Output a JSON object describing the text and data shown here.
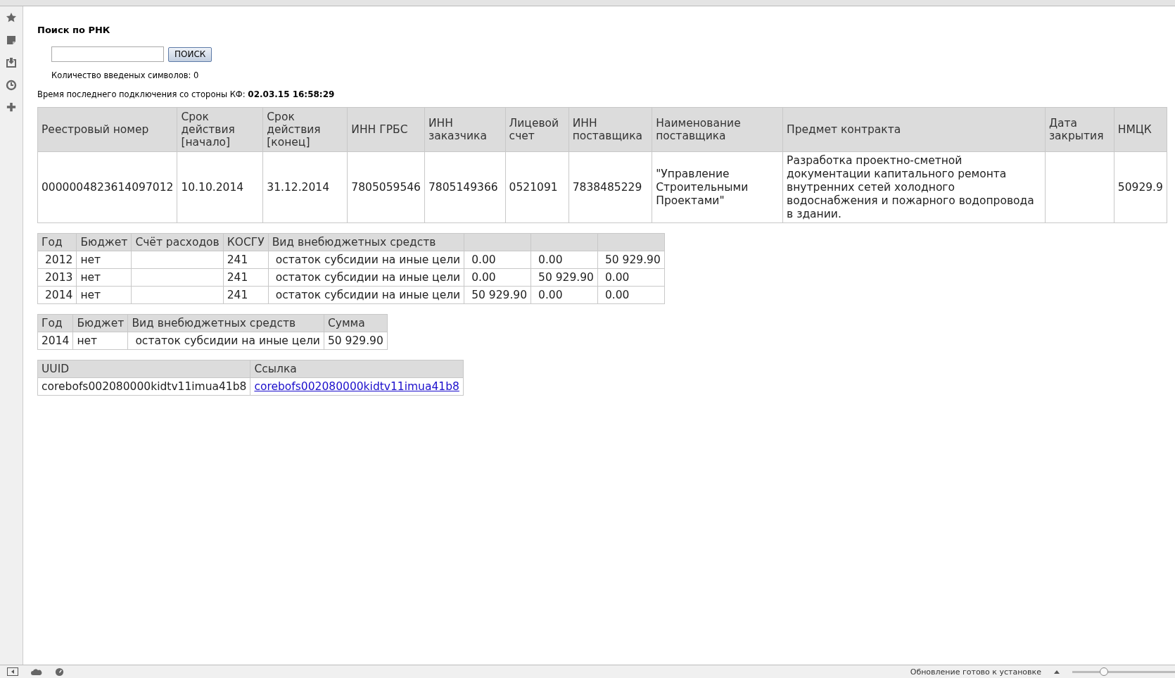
{
  "search": {
    "title": "Поиск по РНК",
    "button": "ПОИСК",
    "counter": "Количество введеных символов: 0"
  },
  "connection": {
    "label": "Время последнего подключения со стороны КФ:",
    "value": "02.03.15 16:58:29"
  },
  "contract_table": {
    "columns": [
      "Реестровый номер",
      "Срок действия [начало]",
      "Срок действия [конец]",
      "ИНН ГРБС",
      "ИНН заказчика",
      "Лицевой счет",
      "ИНН поставщика",
      "Наименование поставщика",
      "Предмет контракта",
      "Дата закрытия",
      "НМЦК"
    ],
    "rows": [
      [
        "0000004823614097012",
        "10.10.2014",
        "31.12.2014",
        "7805059546",
        "7805149366",
        "0521091",
        "7838485229",
        "\"Управление Строительными Проектами\"",
        "Разработка проектно-сметной документации капитального ремонта внутренних сетей холодного водоснабжения и пожарного водопровода в здании.",
        "",
        "50929.9"
      ]
    ]
  },
  "finance_table": {
    "columns": [
      "Год",
      "Бюджет",
      "Счёт расходов",
      "КОСГУ",
      "Вид внебюджетных средств",
      "",
      "",
      ""
    ],
    "rows": [
      [
        "2012",
        "нет",
        "",
        "241",
        "остаток субсидии на иные цели",
        "0.00",
        "0.00",
        "50 929.90"
      ],
      [
        "2013",
        "нет",
        "",
        "241",
        "остаток субсидии на иные цели",
        "0.00",
        "50 929.90",
        "0.00"
      ],
      [
        "2014",
        "нет",
        "",
        "241",
        "остаток субсидии на иные цели",
        "50 929.90",
        "0.00",
        "0.00"
      ]
    ]
  },
  "sum_table": {
    "columns": [
      "Год",
      "Бюджет",
      "Вид внебюджетных средств",
      "Сумма"
    ],
    "rows": [
      [
        "2014",
        "нет",
        "остаток субсидии на иные цели",
        "50 929.90"
      ]
    ]
  },
  "uuid_table": {
    "columns": [
      "UUID",
      "Ссылка"
    ],
    "rows": [
      {
        "uuid": "corebofs002080000kidtv11imua41b8",
        "link": "corebofs002080000kidtv11imua41b8"
      }
    ]
  },
  "status_bar": {
    "text": "Обновление готово к установке",
    "zoom": {
      "level": 0.3
    }
  }
}
